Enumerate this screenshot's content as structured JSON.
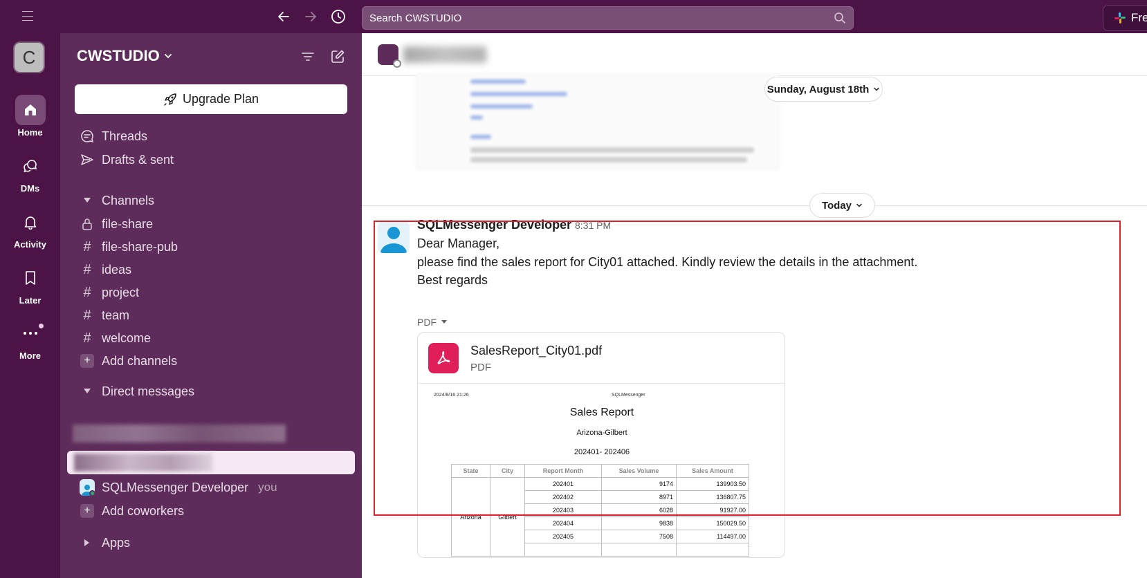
{
  "topbar": {
    "search_placeholder": "Search CWSTUDIO",
    "upgrade_chip": "Fre"
  },
  "rail": {
    "workspace_initial": "C",
    "items": [
      {
        "label": "Home",
        "icon": "home-icon"
      },
      {
        "label": "DMs",
        "icon": "dms-icon"
      },
      {
        "label": "Activity",
        "icon": "bell-icon"
      },
      {
        "label": "Later",
        "icon": "bookmark-icon"
      },
      {
        "label": "More",
        "icon": "more-icon"
      }
    ]
  },
  "sidebar": {
    "workspace_name": "CWSTUDIO",
    "upgrade_label": "Upgrade Plan",
    "threads": "Threads",
    "drafts": "Drafts & sent",
    "channels_header": "Channels",
    "channels": [
      "file-share",
      "file-share-pub",
      "ideas",
      "project",
      "team",
      "welcome"
    ],
    "add_channels": "Add channels",
    "dm_header": "Direct messages",
    "dm_self": "SQLMessenger Developer",
    "dm_self_tag": "you",
    "add_coworkers": "Add coworkers",
    "apps": "Apps"
  },
  "main": {
    "date_pill_prev": "Sunday, August 18th",
    "date_pill_today": "Today",
    "message": {
      "sender": "SQLMessenger Developer",
      "time": "8:31 PM",
      "lines": [
        "Dear Manager,",
        "please find the sales report for City01 attached. Kindly review the details in the attachment.",
        "Best regards"
      ],
      "attach_toggle": "PDF",
      "file": {
        "name": "SalesReport_City01.pdf",
        "type": "PDF"
      }
    },
    "preview": {
      "timestamp": "2024/8/16 21:26",
      "brand": "SQLMessenger",
      "title": "Sales Report",
      "region": "Arizona-Gilbert",
      "period": "202401- 202406",
      "columns": [
        "State",
        "City",
        "Report Month",
        "Sales Volume",
        "Sales Amount"
      ],
      "state": "Arizona",
      "city": "Gilbert",
      "rows": [
        [
          "202401",
          "9174",
          "139903.50"
        ],
        [
          "202402",
          "8971",
          "136807.75"
        ],
        [
          "202403",
          "6028",
          "91927.00"
        ],
        [
          "202404",
          "9838",
          "150029.50"
        ],
        [
          "202405",
          "7508",
          "114497.00"
        ]
      ]
    }
  },
  "colors": {
    "aubergine": "#4b1346",
    "sidebar": "#5d2c5a",
    "highlight": "#e0212b",
    "pdf": "#e01e5a"
  }
}
